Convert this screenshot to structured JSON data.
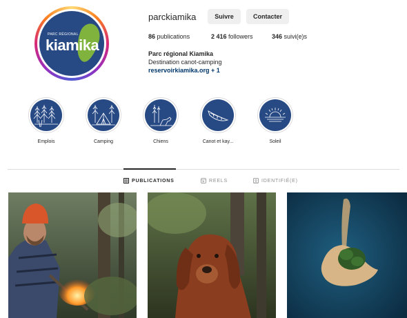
{
  "profile": {
    "username": "parckiamika",
    "follow_label": "Suivre",
    "contact_label": "Contacter",
    "logo_small_text": "PARC RÉGIONAL",
    "logo_word": "kiamika",
    "stats": {
      "posts_count": "86",
      "posts_label": "publications",
      "followers_count": "2 416",
      "followers_label": "followers",
      "following_count": "346",
      "following_label": "suivi(e)s"
    },
    "bio_name": "Parc régional Kiamika",
    "bio_text": "Destination canot-camping",
    "bio_link": "reservoirkiamika.org + 1"
  },
  "highlights": [
    {
      "label": "Emplois",
      "icon": "forest-worker-icon"
    },
    {
      "label": "Camping",
      "icon": "tent-icon"
    },
    {
      "label": "Chiens",
      "icon": "dog-icon"
    },
    {
      "label": "Canot et kay...",
      "icon": "canoe-icon"
    },
    {
      "label": "Soleil",
      "icon": "sunrise-icon"
    }
  ],
  "tabs": [
    {
      "label": "PUBLICATIONS",
      "icon": "grid-icon",
      "active": true
    },
    {
      "label": "REELS",
      "icon": "reels-icon",
      "active": false
    },
    {
      "label": "IDENTIFIÉ(E)",
      "icon": "tag-icon",
      "active": false
    }
  ],
  "colors": {
    "brand_navy": "#274a85",
    "logo_green": "#7fb33e",
    "link": "#00376b",
    "button_bg": "#efefef"
  }
}
